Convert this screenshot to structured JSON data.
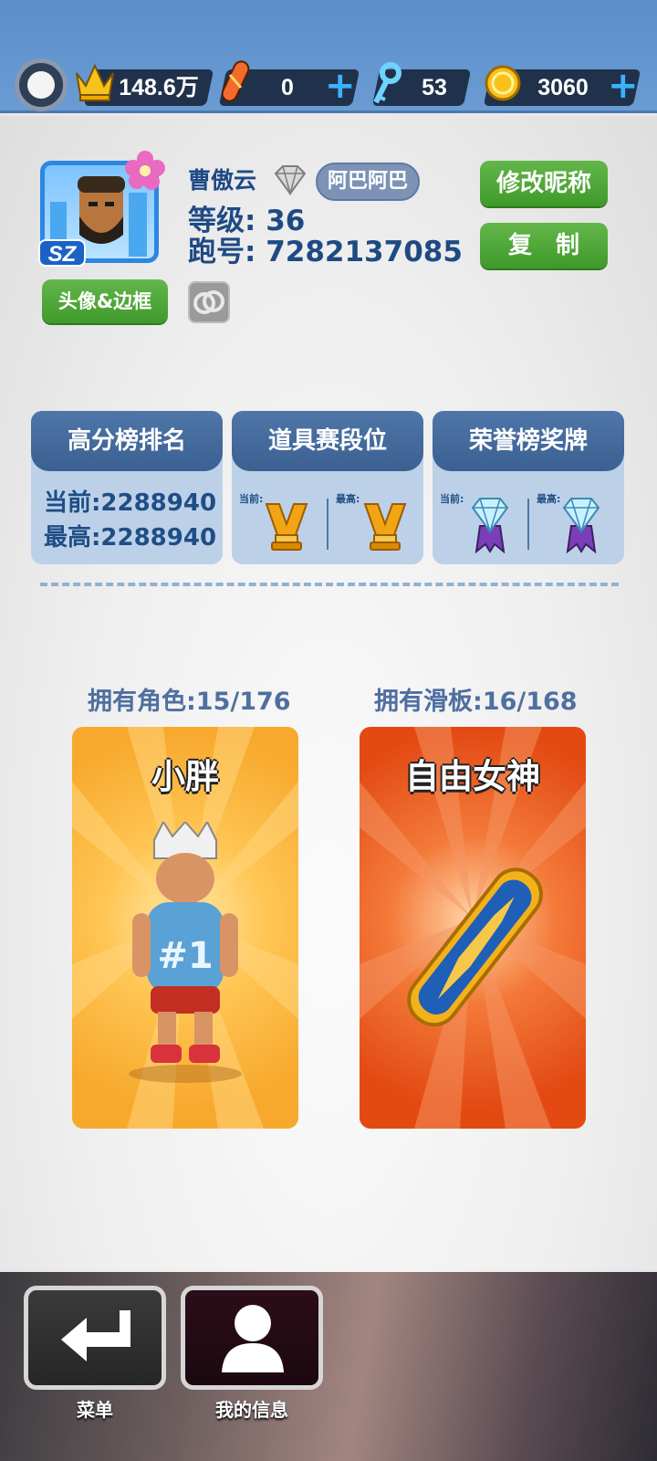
{
  "topbar": {
    "crowns": "148.6万",
    "boards": "0",
    "keys": "53",
    "coins": "3060"
  },
  "profile": {
    "name": "曹傲云",
    "tag": "阿巴阿巴",
    "level_label": "等级:",
    "level": "36",
    "id_label": "跑号:",
    "id": "7282137085",
    "avatar_badge": "SZ",
    "avatar_button": "头像&边框",
    "rename_button": "修改昵称",
    "copy_button": "复　制"
  },
  "stats": {
    "highscore": {
      "title": "高分榜排名",
      "current": "当前:2288940",
      "best": "最高:2288940"
    },
    "items": {
      "title": "道具赛段位",
      "current_label": "当前:",
      "best_label": "最高:"
    },
    "honor": {
      "title": "荣誉榜奖牌",
      "current_label": "当前:",
      "best_label": "最高:"
    }
  },
  "owned": {
    "characters_label": "拥有角色:15/176",
    "boards_label": "拥有滑板:16/168",
    "character_name": "小胖",
    "board_name": "自由女神"
  },
  "nav": {
    "menu_label": "菜单",
    "info_label": "我的信息"
  },
  "colors": {
    "topbar": "#6a9bd3",
    "accent_green": "#4fa836",
    "card_blue": "#bcd1e8",
    "text_blue": "#1e4a84",
    "char_card": "#f5a52a",
    "board_card": "#e24a12"
  }
}
